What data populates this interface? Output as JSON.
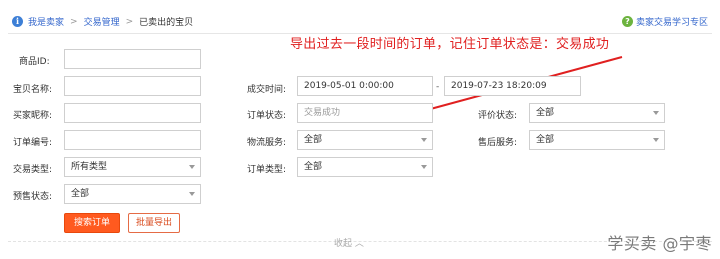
{
  "breadcrumb": {
    "items": [
      "我是卖家",
      "交易管理",
      "已卖出的宝贝"
    ]
  },
  "help": {
    "label": "卖家交易学习专区"
  },
  "annotation": {
    "text": "导出过去一段时间的订单，记住订单状态是：交易成功"
  },
  "form": {
    "product_id": {
      "label": "商品ID:",
      "value": ""
    },
    "item_name": {
      "label": "宝贝名称:",
      "value": ""
    },
    "buyer_nick": {
      "label": "买家昵称:",
      "value": ""
    },
    "order_no": {
      "label": "订单编号:",
      "value": ""
    },
    "trade_type": {
      "label": "交易类型:",
      "value": "所有类型"
    },
    "presale_status": {
      "label": "预售状态:",
      "value": "全部"
    },
    "deal_time": {
      "label": "成交时间:",
      "start": "2019-05-01 0:00:00",
      "end": "2019-07-23 18:20:09"
    },
    "order_status": {
      "label": "订单状态:",
      "value": "交易成功"
    },
    "logistics": {
      "label": "物流服务:",
      "value": "全部"
    },
    "order_type": {
      "label": "订单类型:",
      "value": "全部"
    },
    "review_status": {
      "label": "评价状态:",
      "value": "全部"
    },
    "after_sale": {
      "label": "售后服务:",
      "value": "全部"
    }
  },
  "buttons": {
    "search": "搜索订单",
    "export": "批量导出"
  },
  "collapse": {
    "label": "收起 ︿"
  },
  "watermark": {
    "text": "学买卖 @宇枣"
  },
  "colors": {
    "accent": "#ff5a1f",
    "link": "#3366cc",
    "annotation": "#e02020"
  }
}
